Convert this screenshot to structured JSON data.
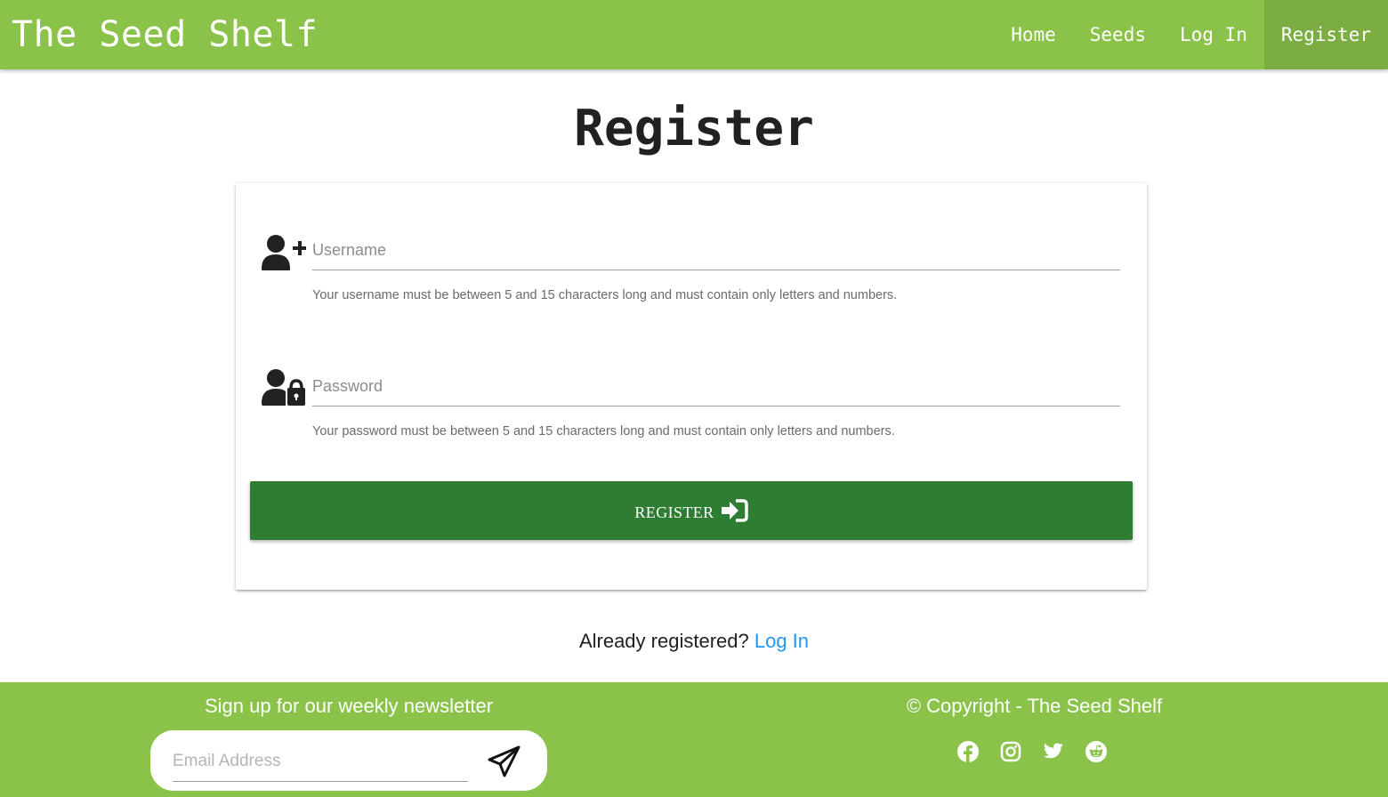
{
  "navbar": {
    "brand": "The Seed Shelf",
    "links": [
      {
        "label": "Home",
        "icon": ""
      },
      {
        "label": "Seeds",
        "icon": ""
      },
      {
        "label": "Log In",
        "icon": ""
      },
      {
        "label": "Register",
        "icon": "",
        "active": true
      }
    ]
  },
  "page": {
    "title": "Register"
  },
  "form": {
    "username": {
      "icon": "user-plus-icon",
      "placeholder": "Username",
      "value": "",
      "helper": "Your username must be between 5 and 15 characters long and must contain only letters and numbers."
    },
    "password": {
      "icon": "user-lock-icon",
      "placeholder": "Password",
      "value": "",
      "helper": "Your password must be between 5 and 15 characters long and must contain only letters and numbers."
    },
    "submit": {
      "label": "REGISTER",
      "icon": "sign-in-icon"
    }
  },
  "login_prompt": {
    "text": "Already registered?",
    "link": "Log In"
  },
  "footer": {
    "newsletter_title": "Sign up for our weekly newsletter",
    "email_placeholder": "Email Address",
    "send_icon": "paper-plane-icon",
    "copyright": "© Copyright - The Seed Shelf",
    "socials": [
      "facebook-icon",
      "instagram-icon",
      "twitter-icon",
      "reddit-icon"
    ]
  },
  "colors": {
    "primary": "#8bc34a",
    "active_nav": "#7cad42",
    "button": "#2e7d32",
    "link": "#2196f3"
  }
}
